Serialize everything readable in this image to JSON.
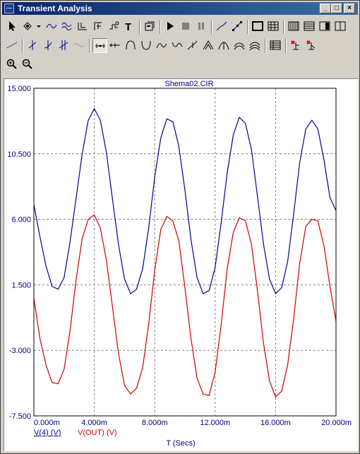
{
  "window": {
    "title": "Transient Analysis"
  },
  "colors": {
    "title_start": "#0a246a",
    "title_end": "#3a6ea5",
    "axis_text": "#000080",
    "grid": "#808080",
    "series1": "#000099",
    "series2": "#d00000"
  },
  "toolbar": {
    "row1": [
      "select-arrow-icon",
      "component-icon",
      "dropdown-icon",
      "wire-icon",
      "bus-icon",
      "junction-icon",
      "ground-icon",
      "source-icon",
      "text-icon",
      "properties-icon",
      "run-icon",
      "stop-icon",
      "pause-icon",
      "line-icon",
      "diagonal-icon",
      "box-icon",
      "grid-icon",
      "layout-1-icon",
      "layout-2-icon",
      "layout-3-icon",
      "layout-4-icon"
    ],
    "row2": [
      "tracker-icon",
      "cursor-left-icon",
      "cursor-right-icon",
      "cursor-both-icon",
      "trace-icon",
      "peak-icon",
      "valley-icon",
      "high-icon",
      "low-icon",
      "inflection-icon",
      "global-high-icon",
      "global-low-icon",
      "slope-icon",
      "rise-icon",
      "fall-icon",
      "table-icon",
      "tag-mode-icon",
      "label-mode-icon"
    ],
    "row3": [
      "zoom-in-icon",
      "zoom-out-icon"
    ]
  },
  "chart_data": {
    "type": "line",
    "title": "Shema02.CIR",
    "xlabel": "T (Secs)",
    "ylabel": "",
    "xlim": [
      0,
      20
    ],
    "ylim": [
      -7.5,
      15
    ],
    "x_tick_labels": [
      "0.000m",
      "4.000m",
      "8.000m",
      "12.000m",
      "16.000m",
      "20.000m"
    ],
    "y_tick_labels": [
      "15.000",
      "10.500",
      "6.000",
      "1.500",
      "-3.000",
      "-7.500"
    ],
    "grid": true,
    "legend_placement": "bottom-left",
    "x_units": "ms",
    "series": [
      {
        "name": "V(4) (V)",
        "color": "#000099",
        "x": [
          0,
          0.4,
          0.8,
          1.2,
          1.6,
          2.0,
          2.4,
          2.8,
          3.2,
          3.6,
          4.0,
          4.4,
          4.8,
          5.2,
          5.6,
          6.0,
          6.4,
          6.8,
          7.2,
          7.6,
          8.0,
          8.4,
          8.8,
          9.2,
          9.6,
          10.0,
          10.4,
          10.8,
          11.2,
          11.6,
          12.0,
          12.4,
          12.8,
          13.2,
          13.6,
          14.0,
          14.4,
          14.8,
          15.2,
          15.6,
          16.0,
          16.4,
          16.8,
          17.2,
          17.6,
          18.0,
          18.4,
          18.8,
          19.2,
          19.6,
          20.0
        ],
        "values": [
          7.0,
          4.8,
          2.8,
          1.4,
          1.2,
          2.0,
          4.5,
          7.5,
          10.5,
          12.8,
          13.6,
          12.8,
          10.6,
          7.4,
          4.3,
          1.9,
          0.9,
          1.2,
          2.6,
          5.4,
          8.9,
          11.6,
          12.9,
          12.7,
          11.0,
          8.0,
          4.6,
          2.0,
          0.9,
          1.1,
          2.7,
          5.8,
          9.2,
          11.8,
          13.0,
          12.6,
          10.8,
          7.6,
          4.3,
          1.9,
          0.9,
          1.3,
          3.1,
          6.4,
          9.9,
          12.2,
          12.8,
          12.2,
          10.1,
          7.5,
          6.6
        ]
      },
      {
        "name": "V(OUT) (V)",
        "color": "#d00000",
        "x": [
          0,
          0.4,
          0.8,
          1.2,
          1.6,
          2.0,
          2.4,
          2.8,
          3.2,
          3.6,
          4.0,
          4.4,
          4.8,
          5.2,
          5.6,
          6.0,
          6.4,
          6.8,
          7.2,
          7.6,
          8.0,
          8.4,
          8.8,
          9.2,
          9.6,
          10.0,
          10.4,
          10.8,
          11.2,
          11.6,
          12.0,
          12.4,
          12.8,
          13.2,
          13.6,
          14.0,
          14.4,
          14.8,
          15.2,
          15.6,
          16.0,
          16.4,
          16.8,
          17.2,
          17.6,
          18.0,
          18.4,
          18.8,
          19.2,
          19.6,
          20.0
        ],
        "values": [
          0.6,
          -2.2,
          -4.0,
          -5.2,
          -5.3,
          -4.3,
          -1.6,
          1.9,
          4.7,
          6.0,
          6.3,
          5.4,
          3.2,
          0.0,
          -3.2,
          -5.4,
          -6.0,
          -5.6,
          -4.2,
          -1.2,
          2.5,
          5.3,
          6.2,
          5.9,
          4.5,
          1.3,
          -2.2,
          -4.9,
          -6.0,
          -6.1,
          -4.5,
          -1.2,
          2.6,
          5.1,
          6.1,
          5.9,
          4.3,
          1.1,
          -2.5,
          -5.1,
          -6.2,
          -5.8,
          -4.0,
          -0.8,
          3.0,
          5.5,
          6.0,
          5.9,
          4.2,
          1.4,
          -1.0
        ]
      }
    ]
  }
}
